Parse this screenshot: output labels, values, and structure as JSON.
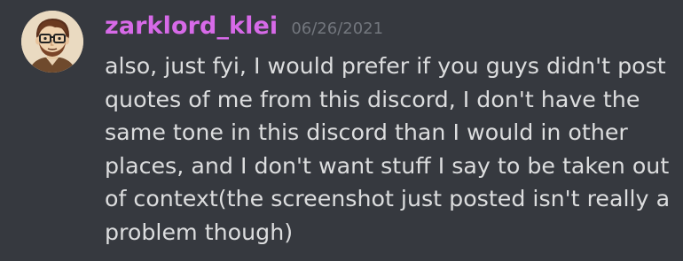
{
  "message": {
    "username": "zarklord_klei",
    "timestamp": "06/26/2021",
    "text": "also, just fyi, I would prefer if you guys didn't post\nquotes of me from this discord, I don't have the\nsame tone in this discord than I would in other\nplaces, and I don't want stuff I say to be taken out\nof context(the screenshot just posted isn't really a\nproblem though)",
    "username_color": "#d76ae8",
    "text_color": "#dcddde",
    "timestamp_color": "#72767d",
    "background_color": "#36393f",
    "avatar_icon": "cartoon-man-with-glasses-avatar"
  }
}
